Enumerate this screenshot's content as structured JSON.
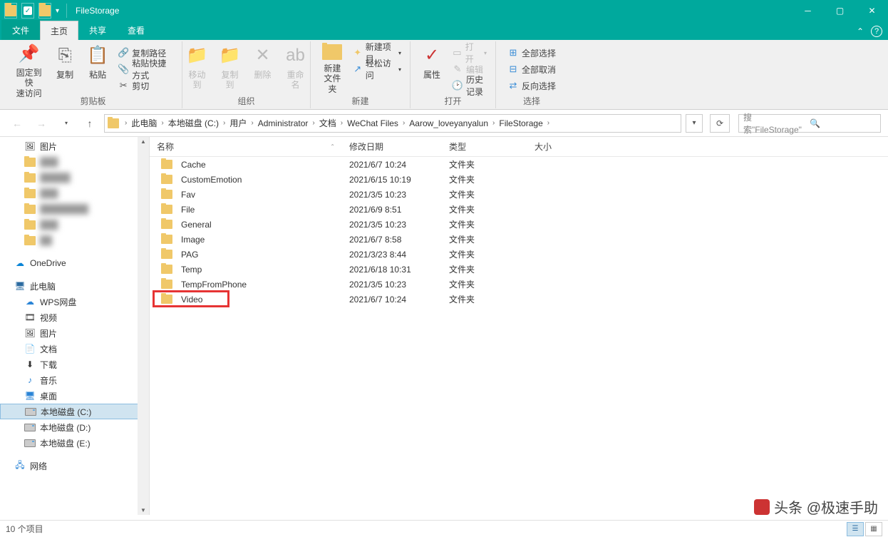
{
  "window": {
    "title": "FileStorage"
  },
  "tabs": {
    "file": "文件",
    "home": "主页",
    "share": "共享",
    "view": "查看"
  },
  "ribbon": {
    "clipboard": {
      "pin": "固定到快\n速访问",
      "copy": "复制",
      "paste": "粘贴",
      "cut": "剪切",
      "copypath": "复制路径",
      "pasteshort": "粘贴快捷方式",
      "label": "剪贴板"
    },
    "organize": {
      "moveto": "移动到",
      "copyto": "复制到",
      "delete": "删除",
      "rename": "重命名",
      "label": "组织"
    },
    "new": {
      "newfolder": "新建\n文件夹",
      "newitem": "新建项目",
      "easyaccess": "轻松访问",
      "label": "新建"
    },
    "open": {
      "properties": "属性",
      "open": "打开",
      "edit": "编辑",
      "history": "历史记录",
      "label": "打开"
    },
    "select": {
      "selectall": "全部选择",
      "selectnone": "全部取消",
      "invert": "反向选择",
      "label": "选择"
    }
  },
  "breadcrumb": [
    "此电脑",
    "本地磁盘 (C:)",
    "用户",
    "Administrator",
    "文档",
    "WeChat Files",
    "Aarow_loveyanyalun",
    "FileStorage"
  ],
  "search": {
    "placeholder": "搜索\"FileStorage\""
  },
  "columns": {
    "name": "名称",
    "date": "修改日期",
    "type": "类型",
    "size": "大小"
  },
  "rows": [
    {
      "name": "Cache",
      "date": "2021/6/7 10:24",
      "type": "文件夹"
    },
    {
      "name": "CustomEmotion",
      "date": "2021/6/15 10:19",
      "type": "文件夹"
    },
    {
      "name": "Fav",
      "date": "2021/3/5 10:23",
      "type": "文件夹"
    },
    {
      "name": "File",
      "date": "2021/6/9 8:51",
      "type": "文件夹"
    },
    {
      "name": "General",
      "date": "2021/3/5 10:23",
      "type": "文件夹"
    },
    {
      "name": "Image",
      "date": "2021/6/7 8:58",
      "type": "文件夹"
    },
    {
      "name": "PAG",
      "date": "2021/3/23 8:44",
      "type": "文件夹"
    },
    {
      "name": "Temp",
      "date": "2021/6/18 10:31",
      "type": "文件夹"
    },
    {
      "name": "TempFromPhone",
      "date": "2021/3/5 10:23",
      "type": "文件夹"
    },
    {
      "name": "Video",
      "date": "2021/6/7 10:24",
      "type": "文件夹"
    }
  ],
  "tree": {
    "pictures": "图片",
    "quick": [
      "███",
      "█████",
      "███",
      "████████",
      "███",
      "██"
    ],
    "onedrive": "OneDrive",
    "thispc": "此电脑",
    "wps": "WPS网盘",
    "video": "视频",
    "pics": "图片",
    "docs": "文档",
    "downloads": "下载",
    "music": "音乐",
    "desktop": "桌面",
    "driveC": "本地磁盘 (C:)",
    "driveD": "本地磁盘 (D:)",
    "driveE": "本地磁盘 (E:)",
    "network": "网络"
  },
  "status": {
    "count": "10 个项目"
  },
  "watermark": "头条 @极速手助",
  "highlight_row_index": 9
}
